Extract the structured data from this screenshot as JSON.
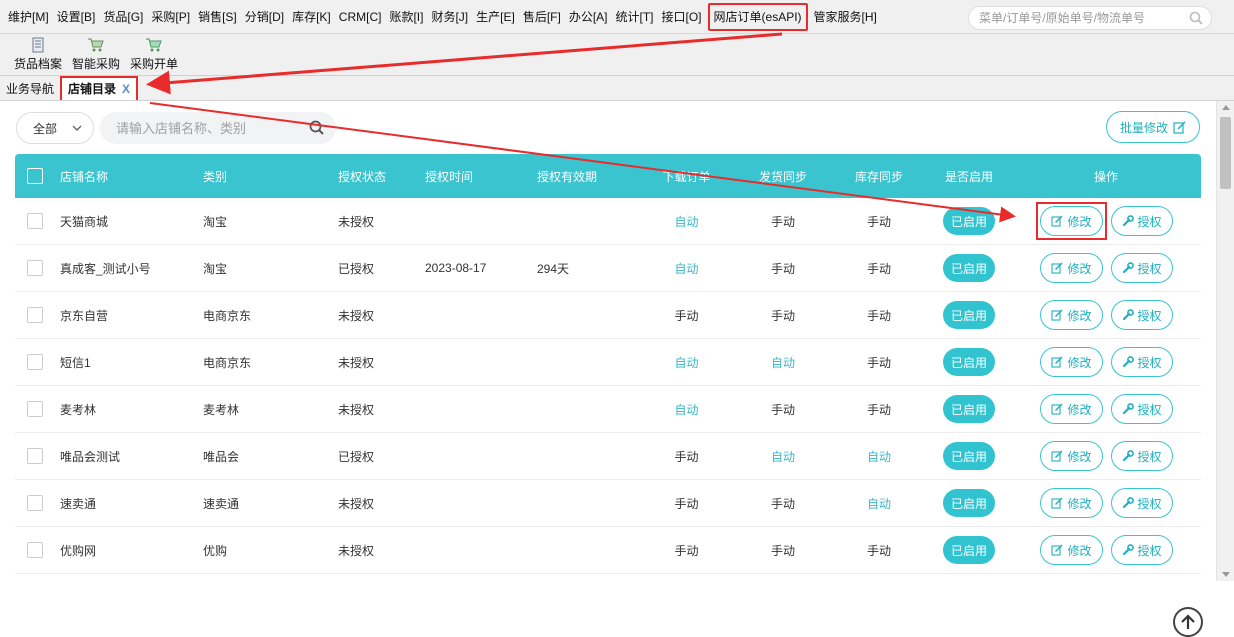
{
  "menu": {
    "items": [
      "维护[M]",
      "设置[B]",
      "货品[G]",
      "采购[P]",
      "销售[S]",
      "分销[D]",
      "库存[K]",
      "CRM[C]",
      "账款[I]",
      "财务[J]",
      "生产[E]",
      "售后[F]",
      "办公[A]",
      "统计[T]",
      "接口[O]",
      "网店订单(esAPI)",
      "管家服务[H]"
    ],
    "highlighted_index": 15
  },
  "top_search": {
    "placeholder": "菜单/订单号/原始单号/物流单号"
  },
  "toolbar": {
    "items": [
      "货品档案",
      "智能采购",
      "采购开单"
    ]
  },
  "tabs": {
    "items": [
      "业务导航",
      "店铺目录"
    ],
    "active_index": 1,
    "close_label": "X"
  },
  "filter": {
    "select_value": "全部",
    "search_placeholder": "请输入店铺名称、类别",
    "batch_label": "批量修改"
  },
  "table": {
    "headers": [
      "店铺名称",
      "类别",
      "授权状态",
      "授权时间",
      "授权有效期",
      "下载订单",
      "发货同步",
      "库存同步",
      "是否启用",
      "操作"
    ],
    "rows": [
      {
        "name": "天猫商城",
        "category": "淘宝",
        "auth": "未授权",
        "time": "",
        "valid": "",
        "download": "自动",
        "ship": "手动",
        "stock": "手动",
        "enabled": "已启用"
      },
      {
        "name": "真成客_测试小号",
        "category": "淘宝",
        "auth": "已授权",
        "time": "2023-08-17",
        "valid": "294天",
        "download": "自动",
        "ship": "手动",
        "stock": "手动",
        "enabled": "已启用"
      },
      {
        "name": "京东自营",
        "category": "电商京东",
        "auth": "未授权",
        "time": "",
        "valid": "",
        "download": "手动",
        "ship": "手动",
        "stock": "手动",
        "enabled": "已启用"
      },
      {
        "name": "短信1",
        "category": "电商京东",
        "auth": "未授权",
        "time": "",
        "valid": "",
        "download": "自动",
        "ship": "自动",
        "stock": "手动",
        "enabled": "已启用"
      },
      {
        "name": "麦考林",
        "category": "麦考林",
        "auth": "未授权",
        "time": "",
        "valid": "",
        "download": "自动",
        "ship": "手动",
        "stock": "手动",
        "enabled": "已启用"
      },
      {
        "name": "唯品会测试",
        "category": "唯品会",
        "auth": "已授权",
        "time": "",
        "valid": "",
        "download": "手动",
        "ship": "自动",
        "stock": "自动",
        "enabled": "已启用"
      },
      {
        "name": "速卖通",
        "category": "速卖通",
        "auth": "未授权",
        "time": "",
        "valid": "",
        "download": "手动",
        "ship": "手动",
        "stock": "自动",
        "enabled": "已启用"
      },
      {
        "name": "优购网",
        "category": "优购",
        "auth": "未授权",
        "time": "",
        "valid": "",
        "download": "手动",
        "ship": "手动",
        "stock": "手动",
        "enabled": "已启用"
      }
    ],
    "edit_label": "修改",
    "authorize_label": "授权",
    "highlighted_edit_row": 0
  },
  "colors": {
    "accent": "#3ac4d0",
    "highlight": "#e82b2b",
    "auto_text": "#3ab7c4"
  },
  "icons": {
    "search": "search-icon",
    "edit": "edit-icon",
    "wrench": "wrench-icon",
    "back_top": "arrow-up-circle-icon"
  }
}
